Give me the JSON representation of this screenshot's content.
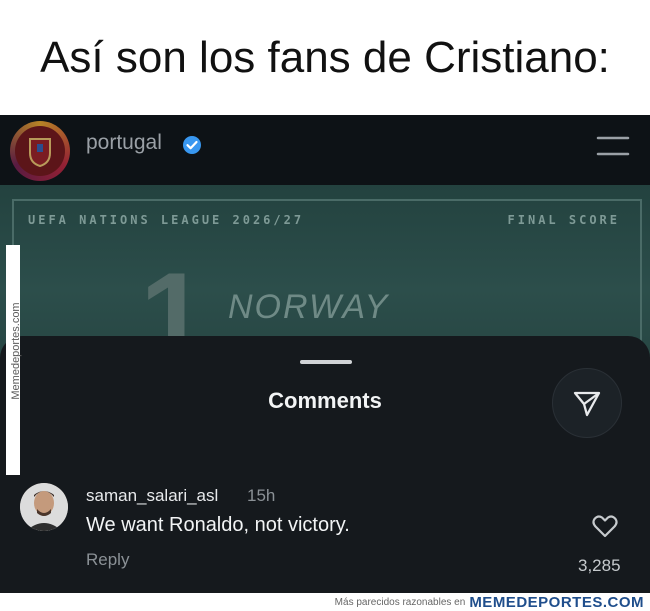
{
  "meme": {
    "title": "Así son los fans de Cristiano:",
    "side_watermark": "Memedeportes.com",
    "footer_small": "Más parecidos razonables en",
    "footer_brand": "MEMEDEPORTES.COM"
  },
  "header": {
    "account_name": "portugal",
    "verified_icon": "verified-badge-icon",
    "menu_icon": "hamburger-menu-icon"
  },
  "post_banner": {
    "league": "UEFA NATIONS LEAGUE 2026/27",
    "label": "FINAL SCORE",
    "score": "1",
    "team": "NORWAY"
  },
  "comments_sheet": {
    "title": "Comments",
    "share_icon": "send-icon",
    "comments": [
      {
        "username": "saman_salari_asl",
        "time": "15h",
        "text": "We want Ronaldo, not victory.",
        "reply_label": "Reply",
        "likes": "3,285",
        "like_icon": "heart-icon"
      }
    ]
  },
  "colors": {
    "background": "#15191d",
    "accent_verified": "#3897f0",
    "banner": "#2c4e4b",
    "brand": "#1f4e8c"
  }
}
